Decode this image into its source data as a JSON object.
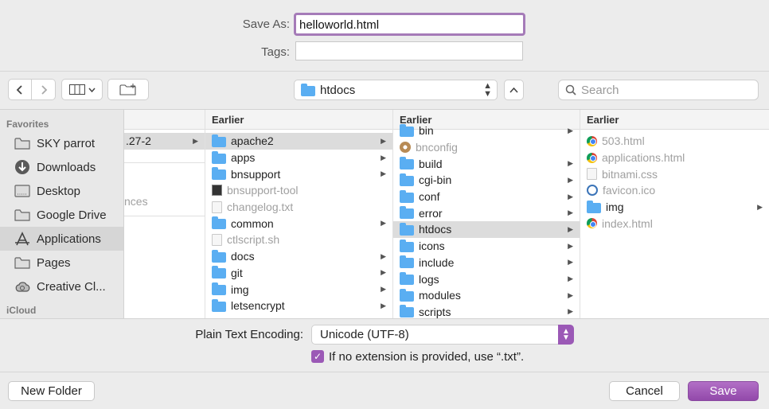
{
  "save_as": {
    "label": "Save As:",
    "filename": "helloworld.html",
    "tags_label": "Tags:",
    "tags_value": ""
  },
  "toolbar": {
    "back_icon": "chevron-left",
    "forward_icon": "chevron-right",
    "view_icon": "column-view",
    "new_folder_icon": "folder-plus",
    "path": "htdocs",
    "search_placeholder": "Search"
  },
  "sidebar": {
    "favorites_heading": "Favorites",
    "items": [
      {
        "label": "SKY parrot",
        "icon": "folder-icon"
      },
      {
        "label": "Downloads",
        "icon": "download-icon"
      },
      {
        "label": "Desktop",
        "icon": "desktop-icon"
      },
      {
        "label": "Google Drive",
        "icon": "folder-icon"
      },
      {
        "label": "Applications",
        "icon": "applications-icon",
        "selected": true
      },
      {
        "label": "Pages",
        "icon": "folder-icon"
      },
      {
        "label": "Creative Cl...",
        "icon": "creative-cloud-icon"
      }
    ],
    "icloud_heading": "iCloud"
  },
  "columns": {
    "col0": {
      "items": [
        ".27-2",
        "nces"
      ]
    },
    "col1": {
      "header": "Earlier",
      "items": [
        {
          "name": "apache2",
          "type": "folder",
          "selected": true,
          "chevron": true
        },
        {
          "name": "apps",
          "type": "folder",
          "chevron": true
        },
        {
          "name": "bnsupport",
          "type": "folder",
          "chevron": true
        },
        {
          "name": "bnsupport-tool",
          "type": "exec",
          "dim": true
        },
        {
          "name": "changelog.txt",
          "type": "doc",
          "dim": true
        },
        {
          "name": "common",
          "type": "folder",
          "chevron": true
        },
        {
          "name": "ctlscript.sh",
          "type": "doc",
          "dim": true
        },
        {
          "name": "docs",
          "type": "folder",
          "chevron": true
        },
        {
          "name": "git",
          "type": "folder",
          "chevron": true
        },
        {
          "name": "img",
          "type": "folder",
          "chevron": true
        },
        {
          "name": "letsencrypt",
          "type": "folder",
          "chevron": true
        }
      ]
    },
    "col2": {
      "header": "Earlier",
      "items": [
        {
          "name": "bin",
          "type": "folder",
          "chevron": true
        },
        {
          "name": "bnconfig",
          "type": "gear",
          "dim": true
        },
        {
          "name": "build",
          "type": "folder",
          "chevron": true
        },
        {
          "name": "cgi-bin",
          "type": "folder",
          "chevron": true
        },
        {
          "name": "conf",
          "type": "folder",
          "chevron": true
        },
        {
          "name": "error",
          "type": "folder",
          "chevron": true
        },
        {
          "name": "htdocs",
          "type": "folder",
          "selected": true,
          "chevron": true
        },
        {
          "name": "icons",
          "type": "folder",
          "chevron": true
        },
        {
          "name": "include",
          "type": "folder",
          "chevron": true
        },
        {
          "name": "logs",
          "type": "folder",
          "chevron": true
        },
        {
          "name": "modules",
          "type": "folder",
          "chevron": true
        },
        {
          "name": "scripts",
          "type": "folder",
          "chevron": true
        }
      ]
    },
    "col3": {
      "header": "Earlier",
      "items": [
        {
          "name": "503.html",
          "type": "chrome",
          "dim": true
        },
        {
          "name": "applications.html",
          "type": "chrome",
          "dim": true
        },
        {
          "name": "bitnami.css",
          "type": "doc",
          "dim": true
        },
        {
          "name": "favicon.ico",
          "type": "fav",
          "dim": true
        },
        {
          "name": "img",
          "type": "folder",
          "chevron": true
        },
        {
          "name": "index.html",
          "type": "chrome",
          "dim": true
        }
      ]
    }
  },
  "encoding": {
    "label": "Plain Text Encoding:",
    "value": "Unicode (UTF-8)",
    "checkbox_checked": true,
    "checkbox_label": "If no extension is provided, use “.txt”."
  },
  "buttons": {
    "new_folder": "New Folder",
    "cancel": "Cancel",
    "save": "Save"
  },
  "colors": {
    "accent": "#9b59b6",
    "folder": "#5aaef2"
  }
}
